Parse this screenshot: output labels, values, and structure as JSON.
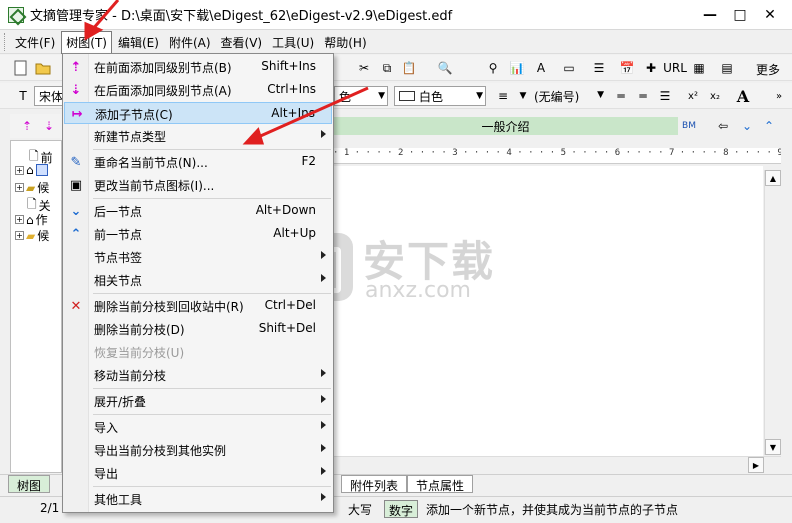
{
  "window": {
    "title": "文摘管理专家 - D:\\桌面\\安下载\\eDigest_62\\eDigest-v2.9\\eDigest.edf",
    "minimize": "—",
    "maximize": "□",
    "close": "✕"
  },
  "menubar": [
    {
      "label": "文件(F)"
    },
    {
      "label": "树图(T)"
    },
    {
      "label": "编辑(E)"
    },
    {
      "label": "附件(A)"
    },
    {
      "label": "查看(V)"
    },
    {
      "label": "工具(U)"
    },
    {
      "label": "帮助(H)"
    }
  ],
  "toolbar": {
    "font_name": "宋体",
    "font_color_label": "色",
    "bg_color_label": "白色",
    "numbering": "(无编号)",
    "more": "更多"
  },
  "right_pane": {
    "section_title": "一般介绍",
    "ruler": "· 1 · · · · 2 · · · · 3 · · · · 4 · · · · 5 · · · · 6 · · · · 7 · · · · 8 · · · · 9 · · · · 10 · · · · 11 · · · · 12 · · ·"
  },
  "tree": {
    "items": [
      {
        "label": "前"
      },
      {
        "label": ""
      },
      {
        "label": "候"
      },
      {
        "label": "关"
      },
      {
        "label": "作"
      },
      {
        "label": "候"
      }
    ]
  },
  "dropdown": {
    "items": [
      {
        "label": "在前面添加同级别节点(B)",
        "shortcut": "Shift+Ins",
        "icon": "up-arrow-icon"
      },
      {
        "label": "在后面添加同级别节点(A)",
        "shortcut": "Ctrl+Ins",
        "icon": "down-arrow-icon"
      },
      {
        "label": "添加子节点(C)",
        "shortcut": "Alt+Ins",
        "icon": "child-arrow-icon"
      },
      {
        "label": "新建节点类型",
        "shortcut": "",
        "icon": ""
      },
      {
        "label": "重命名当前节点(N)...",
        "shortcut": "F2",
        "icon": "pencil-icon"
      },
      {
        "label": "更改当前节点图标(I)...",
        "shortcut": "",
        "icon": "image-icon"
      },
      {
        "label": "后一节点",
        "shortcut": "Alt+Down",
        "icon": "chevron-down-icon"
      },
      {
        "label": "前一节点",
        "shortcut": "Alt+Up",
        "icon": "chevron-up-icon"
      },
      {
        "label": "节点书签",
        "shortcut": "",
        "icon": ""
      },
      {
        "label": "相关节点",
        "shortcut": "",
        "icon": ""
      },
      {
        "label": "删除当前分枝到回收站中(R)",
        "shortcut": "Ctrl+Del",
        "icon": "delete-x-icon"
      },
      {
        "label": "删除当前分枝(D)",
        "shortcut": "Shift+Del",
        "icon": ""
      },
      {
        "label": "恢复当前分枝(U)",
        "shortcut": "",
        "icon": ""
      },
      {
        "label": "移动当前分枝",
        "shortcut": "",
        "icon": ""
      },
      {
        "label": "展开/折叠",
        "shortcut": "",
        "icon": ""
      },
      {
        "label": "导入",
        "shortcut": "",
        "icon": ""
      },
      {
        "label": "导出当前分枝到其他实例",
        "shortcut": "",
        "icon": ""
      },
      {
        "label": "导出",
        "shortcut": "",
        "icon": ""
      },
      {
        "label": "其他工具",
        "shortcut": "",
        "icon": ""
      }
    ]
  },
  "bottom_tabs": [
    {
      "label": "树图"
    },
    {
      "label": "附件列表"
    },
    {
      "label": "节点属性"
    }
  ],
  "status": {
    "page": "2/1",
    "caps": "大写",
    "num": "数字",
    "message": "添加一个新节点，并使其成为当前节点的子节点"
  },
  "watermark": {
    "text": "安下载",
    "sub": "anxz.com"
  },
  "colors": {
    "highlight": "#cce4f7",
    "accent_red": "#e02020",
    "section_green": "#c9e6c9"
  }
}
